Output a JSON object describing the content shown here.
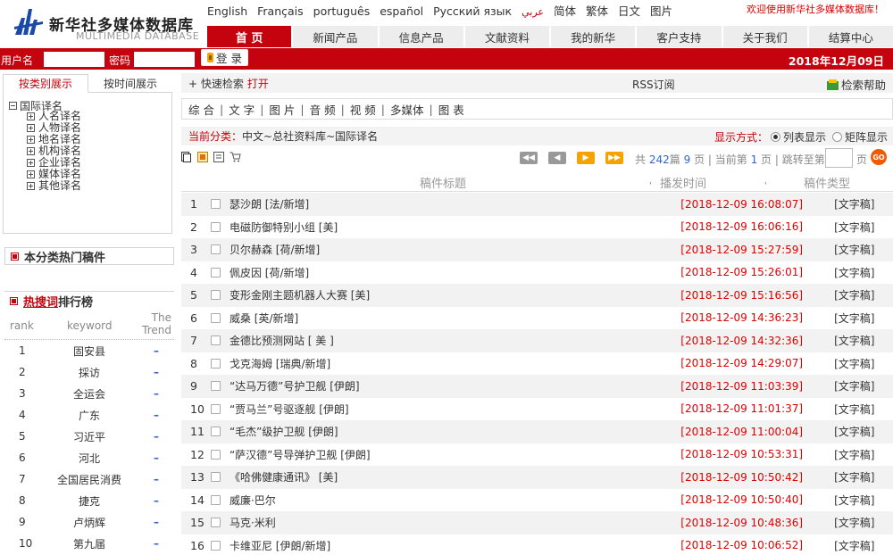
{
  "brand": {
    "name_cn": "新华社多媒体数据库",
    "name_en": "MULTIMEDIA DATABASE"
  },
  "languages": [
    "English",
    "Français",
    "português",
    "español",
    "Русский язык",
    "عربي",
    "简体",
    "繁体",
    "日文",
    "图片"
  ],
  "welcome": "欢迎使用新华社多媒体数据库！",
  "nav": [
    "首 页",
    "新闻产品",
    "信息产品",
    "文献资料",
    "我的新华",
    "客户支持",
    "关于我们",
    "结算中心"
  ],
  "login": {
    "user_label": "用户名",
    "pass_label": "密码",
    "button": "登 录"
  },
  "date": "2018年12月09日",
  "sidebar": {
    "tabs": [
      "按类别展示",
      "按时间展示"
    ],
    "tree_root": "国际译名",
    "tree_nodes": [
      "人名译名",
      "人物译名",
      "地名译名",
      "机构译名",
      "企业译名",
      "媒体译名",
      "其他译名"
    ],
    "hot_panel": "本分类热门稿件",
    "rank_panel": {
      "link": "热搜词",
      "suffix": "排行榜"
    },
    "rank_headers": {
      "rank": "rank",
      "keyword": "keyword",
      "trend": "The Trend"
    },
    "rank_rows": [
      {
        "rank": "1",
        "keyword": "固安县",
        "trend": "–"
      },
      {
        "rank": "2",
        "keyword": "採访",
        "trend": "–"
      },
      {
        "rank": "3",
        "keyword": "全运会",
        "trend": "–"
      },
      {
        "rank": "4",
        "keyword": "广东",
        "trend": "–"
      },
      {
        "rank": "5",
        "keyword": "习近平",
        "trend": "–"
      },
      {
        "rank": "6",
        "keyword": "河北",
        "trend": "–"
      },
      {
        "rank": "7",
        "keyword": "全国居民消费",
        "trend": "–"
      },
      {
        "rank": "8",
        "keyword": "捷克",
        "trend": "–"
      },
      {
        "rank": "9",
        "keyword": "卢炳辉",
        "trend": "–"
      },
      {
        "rank": "10",
        "keyword": "第九届",
        "trend": "–"
      }
    ]
  },
  "quick": {
    "label": "+ 快速检索",
    "open": "打开",
    "rss": "RSS订阅",
    "help": "检索帮助"
  },
  "media_types": [
    "综 合",
    "文 字",
    "图 片",
    "音 频",
    "视 频",
    "多媒体",
    "图 表"
  ],
  "crumb": {
    "label": "当前分类：",
    "path": "中文~总社资料库~国际译名",
    "display_label": "显示方式：",
    "list": "列表显示",
    "matrix": "矩阵显示"
  },
  "pager": {
    "total_prefix": "共",
    "total": "242",
    "total_mid": "篇",
    "pages": "9",
    "pages_suffix": "页 | 当前第",
    "current": "1",
    "current_suffix": "页 | 跳转至第",
    "page_word": "页",
    "go": "GO"
  },
  "table": {
    "headers": {
      "title": "稿件标题",
      "time": "播发时间",
      "type": "稿件类型"
    },
    "rows": [
      {
        "n": "1",
        "title": "瑟沙朗 [法/新增]",
        "time": "[2018-12-09 16:08:07]",
        "type": "[文字稿]"
      },
      {
        "n": "2",
        "title": "电磁防御特别小组 [美]",
        "time": "[2018-12-09 16:06:16]",
        "type": "[文字稿]"
      },
      {
        "n": "3",
        "title": "贝尔赫森 [荷/新增]",
        "time": "[2018-12-09 15:27:59]",
        "type": "[文字稿]"
      },
      {
        "n": "4",
        "title": "佩皮因 [荷/新增]",
        "time": "[2018-12-09 15:26:01]",
        "type": "[文字稿]"
      },
      {
        "n": "5",
        "title": "变形金刚主题机器人大赛 [美]",
        "time": "[2018-12-09 15:16:56]",
        "type": "[文字稿]"
      },
      {
        "n": "6",
        "title": "威桑 [英/新增]",
        "time": "[2018-12-09 14:36:23]",
        "type": "[文字稿]"
      },
      {
        "n": "7",
        "title": "金德比预测网站 [ 美 ]",
        "time": "[2018-12-09 14:32:36]",
        "type": "[文字稿]"
      },
      {
        "n": "8",
        "title": "戈克海姆 [瑞典/新增]",
        "time": "[2018-12-09 14:29:07]",
        "type": "[文字稿]"
      },
      {
        "n": "9",
        "title": "“达马万德”号护卫舰 [伊朗]",
        "time": "[2018-12-09 11:03:39]",
        "type": "[文字稿]"
      },
      {
        "n": "10",
        "title": "“贾马兰”号驱逐舰 [伊朗]",
        "time": "[2018-12-09 11:01:37]",
        "type": "[文字稿]"
      },
      {
        "n": "11",
        "title": "“毛杰”级护卫舰 [伊朗]",
        "time": "[2018-12-09 11:00:04]",
        "type": "[文字稿]"
      },
      {
        "n": "12",
        "title": "“萨汉德”号导弹护卫舰 [伊朗]",
        "time": "[2018-12-09 10:53:31]",
        "type": "[文字稿]"
      },
      {
        "n": "13",
        "title": "《哈佛健康通讯》 [美]",
        "time": "[2018-12-09 10:50:42]",
        "type": "[文字稿]"
      },
      {
        "n": "14",
        "title": "威廉·巴尔",
        "time": "[2018-12-09 10:50:40]",
        "type": "[文字稿]"
      },
      {
        "n": "15",
        "title": "马克·米利",
        "time": "[2018-12-09 10:48:36]",
        "type": "[文字稿]"
      },
      {
        "n": "16",
        "title": "卡维亚尼 [伊朗/新增]",
        "time": "[2018-12-09 10:06:52]",
        "type": "[文字稿]"
      }
    ]
  },
  "colors": {
    "brand_red": "#c4030e",
    "time_red": "#dd0000",
    "link_blue": "#3366cc",
    "pager_orange": "#f4a300"
  }
}
